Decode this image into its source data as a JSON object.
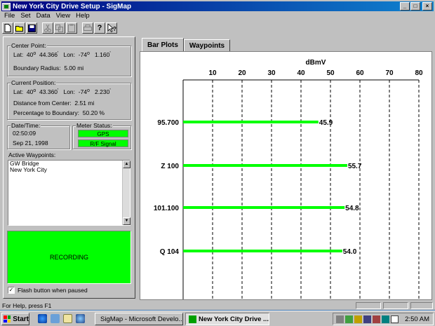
{
  "window": {
    "title": "New York City Drive Setup - SigMap",
    "controls": [
      "_",
      "□",
      "×"
    ]
  },
  "menu": [
    {
      "label": "File"
    },
    {
      "label": "Set"
    },
    {
      "label": "Data"
    },
    {
      "label": "View"
    },
    {
      "label": "Help"
    }
  ],
  "toolbar": {
    "icons": [
      "new-icon",
      "open-icon",
      "save-icon",
      "cut-icon",
      "copy-icon",
      "paste-icon",
      "print-icon",
      "help-icon",
      "context-help-icon"
    ]
  },
  "center_point": {
    "title": "Center Point:",
    "lat_label": "Lat:",
    "lat_deg": "40",
    "lat_min": "44.366",
    "lon_label": "Lon:",
    "lon_deg": "-74",
    "lon_min": "1.160",
    "radius_label": "Boundary Radius:",
    "radius_value": "5.00 mi"
  },
  "current_position": {
    "title": "Current Position:",
    "lat_label": "Lat:",
    "lat_deg": "40",
    "lat_min": "43.360",
    "lon_label": "Lon:",
    "lon_deg": "-74",
    "lon_min": "2.230",
    "distance_label": "Distance from Center:",
    "distance_value": "2.51 mi",
    "pct_label": "Percentage to Boundary:",
    "pct_value": "50.20 %"
  },
  "datetime": {
    "title": "Date/Time:",
    "time": "02:50:09",
    "date": "Sep 21, 1998"
  },
  "meter_status": {
    "title": "Meter Status:",
    "gps": "GPS",
    "rf": "R/F Signal"
  },
  "waypoints": {
    "title": "Active Waypoints:",
    "items": [
      "GW Bridge",
      "New York City"
    ]
  },
  "recording": {
    "label": "RECORDING"
  },
  "flash_option": {
    "label": "Flash button when paused",
    "checked": true
  },
  "tabs": [
    {
      "label": "Bar Plots",
      "active": true
    },
    {
      "label": "Waypoints",
      "active": false
    }
  ],
  "chart_data": {
    "type": "bar",
    "orientation": "horizontal",
    "xlabel": "dBmV",
    "xlim": [
      0,
      80
    ],
    "xticks": [
      10,
      20,
      30,
      40,
      50,
      60,
      70,
      80
    ],
    "categories": [
      "95.700",
      "Z 100",
      "101.100",
      "Q 104"
    ],
    "values": [
      45.9,
      55.7,
      54.8,
      54.0
    ],
    "value_labels": [
      "45.9",
      "55.7",
      "54.8",
      "54.0"
    ],
    "grid": "vertical dashed",
    "bar_color": "#00ff00"
  },
  "statusbar": {
    "text": "For Help, press F1"
  },
  "taskbar": {
    "start_label": "Start",
    "buttons": [
      {
        "label": "SigMap - Microsoft Develo...",
        "active": false
      },
      {
        "label": "New York City Drive ...",
        "active": true
      }
    ],
    "clock": "2:50 AM"
  }
}
